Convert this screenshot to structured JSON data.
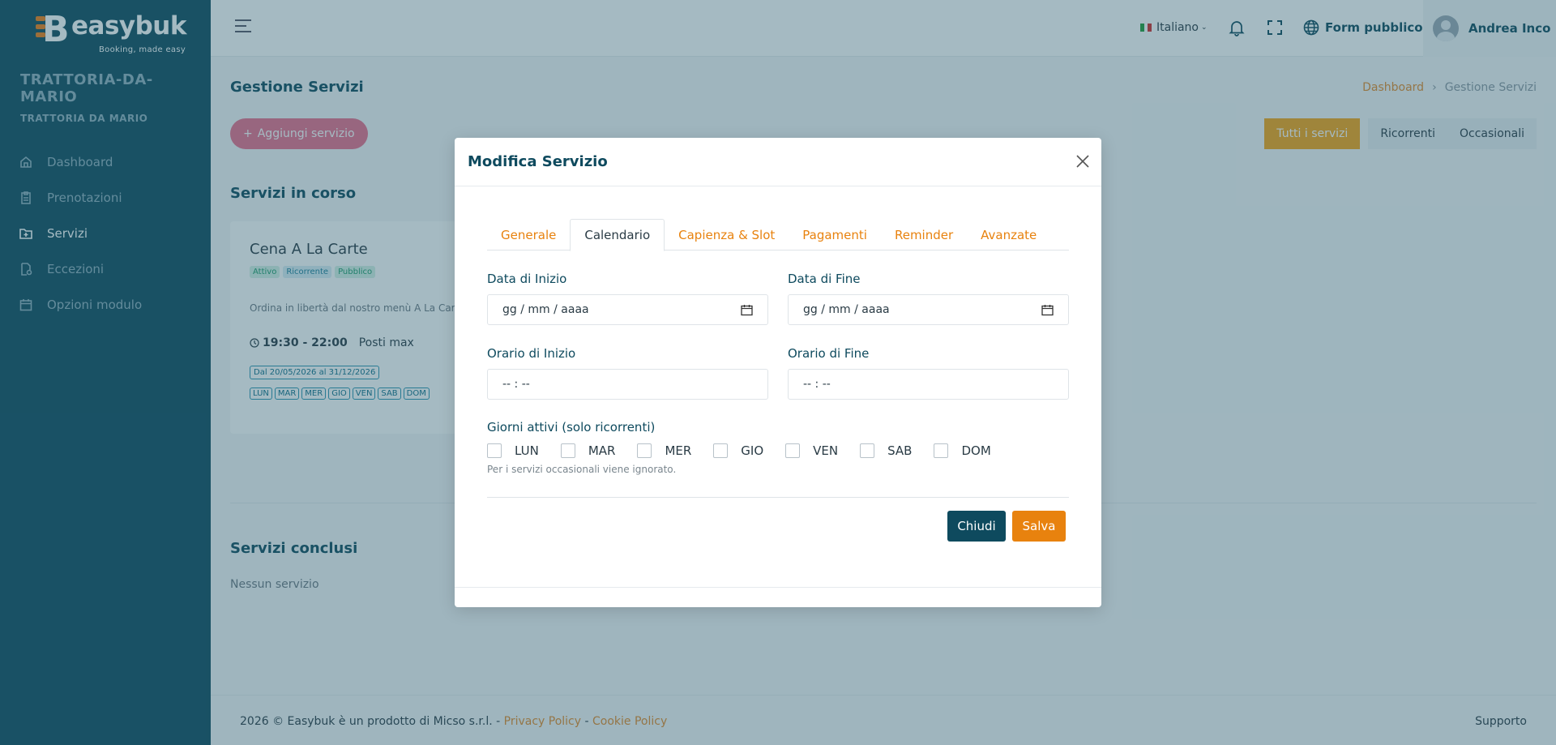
{
  "brand": {
    "logo_text": "easybuk",
    "logo_mark": "B",
    "tagline": "Booking, made easy"
  },
  "org": {
    "name": "TRATTORIA-DA-MARIO",
    "subtitle": "TRATTORIA DA MARIO"
  },
  "sidebar": {
    "items": [
      {
        "label": "Dashboard",
        "icon": "home-icon",
        "active": false
      },
      {
        "label": "Prenotazioni",
        "icon": "clipboard-icon",
        "active": false
      },
      {
        "label": "Servizi",
        "icon": "folder-plus-icon",
        "active": true
      },
      {
        "label": "Eccezioni",
        "icon": "document-gear-icon",
        "active": false
      },
      {
        "label": "Opzioni modulo",
        "icon": "calendar-icon",
        "active": false
      }
    ]
  },
  "topbar": {
    "language": "Italiano",
    "public_form": "Form pubblico",
    "user_name": "Andrea Inco"
  },
  "page": {
    "title": "Gestione Servizi",
    "breadcrumb": {
      "home": "Dashboard",
      "current": "Gestione Servizi"
    },
    "add_button": "Aggiungi servizio",
    "filters": [
      "Tutti i servizi",
      "Ricorrenti",
      "Occasionali"
    ],
    "ongoing_title": "Servizi in corso",
    "finished_title": "Servizi conclusi",
    "no_service": "Nessun servizio"
  },
  "service_card": {
    "title": "Cena A La Carte",
    "badges": [
      "Attivo",
      "Ricorrente",
      "Pubblico"
    ],
    "description": "Ordina in libertà dal nostro menù A La Carte",
    "time": "19:30 - 22:00",
    "seats": "Posti max",
    "period": "Dal 20/05/2026 al 31/12/2026",
    "days": [
      "LUN",
      "MAR",
      "MER",
      "GIO",
      "VEN",
      "SAB",
      "DOM"
    ]
  },
  "footer": {
    "text": "2026 © Easybuk è un prodotto di Micso s.r.l. -",
    "privacy": "Privacy Policy",
    "cookie": "Cookie Policy",
    "dash": "-",
    "support": "Supporto"
  },
  "modal": {
    "title": "Modifica Servizio",
    "tabs": [
      "Generale",
      "Calendario",
      "Capienza & Slot",
      "Pagamenti",
      "Reminder",
      "Avanzate"
    ],
    "active_tab": "Calendario",
    "start_date": {
      "label": "Data di Inizio",
      "value": "gg / mm / aaaa"
    },
    "end_date": {
      "label": "Data di Fine",
      "value": "gg / mm / aaaa"
    },
    "start_time": {
      "label": "Orario di Inizio",
      "value": "-- : --"
    },
    "end_time": {
      "label": "Orario di Fine",
      "value": "-- : --"
    },
    "days_label": "Giorni attivi (solo ricorrenti)",
    "days": [
      "LUN",
      "MAR",
      "MER",
      "GIO",
      "VEN",
      "SAB",
      "DOM"
    ],
    "hint": "Per i servizi occasionali viene ignorato.",
    "close_button": "Chiudi",
    "save_button": "Salva"
  },
  "colors": {
    "sidebar": "#0e4a5e",
    "accent": "#e8820e",
    "filter_active": "#f5a418",
    "add_button": "#e86f8c"
  }
}
